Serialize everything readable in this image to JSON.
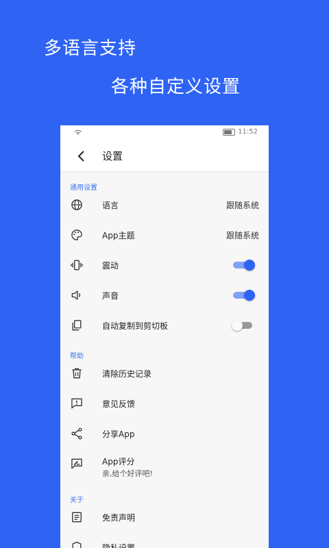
{
  "promo": {
    "line1": "多语言支持",
    "line2": "各种自定义设置"
  },
  "status_bar": {
    "time": "11:52"
  },
  "app_bar": {
    "title": "设置"
  },
  "sections": {
    "general": "通用设置",
    "help": "帮助",
    "about": "关于"
  },
  "general_items": {
    "language": {
      "label": "语言",
      "value": "跟随系统"
    },
    "theme": {
      "label": "App主题",
      "value": "跟随系统"
    },
    "vibration": {
      "label": "震动",
      "enabled": true
    },
    "sound": {
      "label": "声音",
      "enabled": true
    },
    "auto_copy": {
      "label": "自动复制到剪切板",
      "enabled": false
    }
  },
  "help_items": {
    "clear_history": {
      "label": "清除历史记录"
    },
    "feedback": {
      "label": "意见反馈"
    },
    "share": {
      "label": "分享App"
    },
    "rate": {
      "label": "App评分",
      "sub": "亲,给个好评吧!"
    }
  },
  "about_items": {
    "disclaimer": {
      "label": "免责声明"
    },
    "privacy": {
      "label": "隐私设置"
    }
  },
  "colors": {
    "background": "#2e63f4",
    "accent": "#3d74f0"
  }
}
